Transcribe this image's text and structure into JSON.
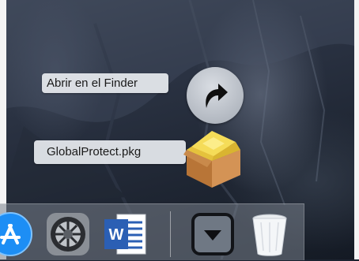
{
  "context_menu": {
    "open_in_finder_label": "Abrir en el Finder",
    "file_name_label": "GlobalProtect.pkg"
  },
  "icons": {
    "open_in_finder": "curved-arrow-icon",
    "package_file": "package-icon"
  },
  "dock": {
    "items": [
      {
        "name": "app-store-icon"
      },
      {
        "name": "system-preferences-icon"
      },
      {
        "name": "word-icon",
        "letter": "W"
      },
      {
        "name": "downloads-stack-icon"
      },
      {
        "name": "trash-icon"
      }
    ]
  },
  "colors": {
    "app_store": "#1d8ef5",
    "word_blue": "#2b5fb4",
    "package_box": "#c98a4b",
    "package_lid": "#f2d44c"
  }
}
